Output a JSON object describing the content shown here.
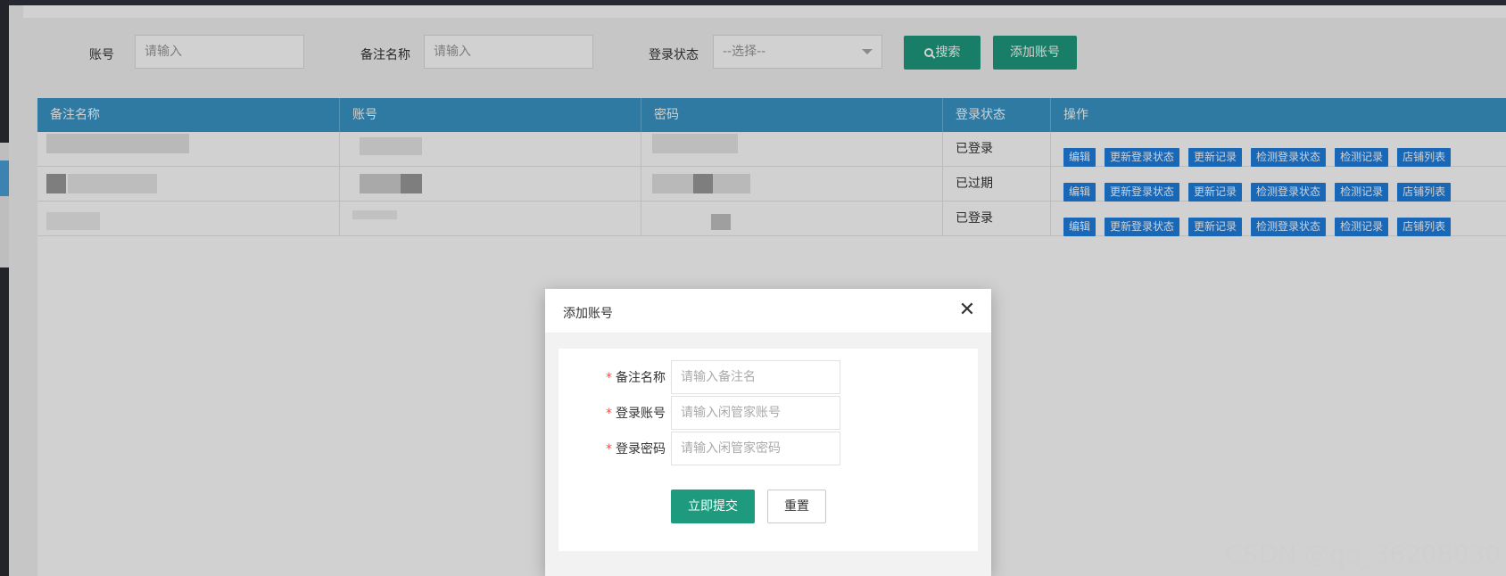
{
  "search": {
    "account_label": "账号",
    "account_placeholder": "请输入",
    "remark_label": "备注名称",
    "remark_placeholder": "请输入",
    "status_label": "登录状态",
    "status_select_value": "--选择--",
    "search_button": "搜索",
    "add_button": "添加账号"
  },
  "table": {
    "headers": [
      "备注名称",
      "账号",
      "密码",
      "登录状态",
      "操作"
    ],
    "rows": [
      {
        "status": "已登录"
      },
      {
        "status": "已过期"
      },
      {
        "status": "已登录"
      }
    ],
    "actions": [
      "编辑",
      "更新登录状态",
      "更新记录",
      "检测登录状态",
      "检测记录",
      "店铺列表"
    ]
  },
  "modal": {
    "title": "添加账号",
    "close_icon": "close-icon",
    "fields": [
      {
        "label": "备注名称",
        "placeholder": "请输入备注名"
      },
      {
        "label": "登录账号",
        "placeholder": "请输入闲管家账号"
      },
      {
        "label": "登录密码",
        "placeholder": "请输入闲管家密码"
      }
    ],
    "required_mark": "*",
    "submit_button": "立即提交",
    "reset_button": "重置"
  },
  "watermark": "CSDN @qq_36208030",
  "colors": {
    "primary_green": "#1e9a7e",
    "table_header": "#3a95c6",
    "action_blue": "#1e7fe0",
    "required_red": "#ff4d4f"
  }
}
